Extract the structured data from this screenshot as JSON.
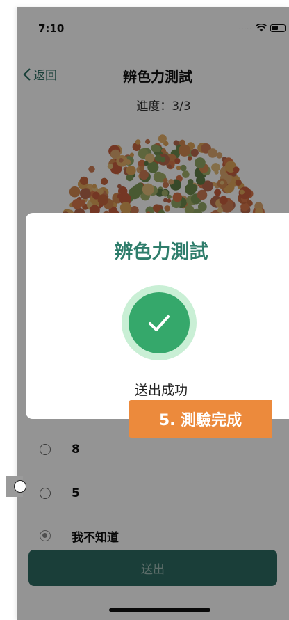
{
  "status_bar": {
    "time": "7:10",
    "signal": "....."
  },
  "nav": {
    "back_label": "返回",
    "title": "辨色力測試"
  },
  "progress_text": "進度：3/3",
  "options": [
    {
      "label": "8",
      "selected": false
    },
    {
      "label": "5",
      "selected": false
    },
    {
      "label": "我不知道",
      "selected": true
    }
  ],
  "submit_label": "送出",
  "modal": {
    "title": "辨色力測試",
    "message": "送出成功"
  },
  "step_badge": "5. 測驗完成",
  "colors": {
    "accent": "#2e7d6b",
    "submit_bg": "#2d6b62",
    "success_green": "#35a86b",
    "badge_orange": "#ec8a3c"
  }
}
